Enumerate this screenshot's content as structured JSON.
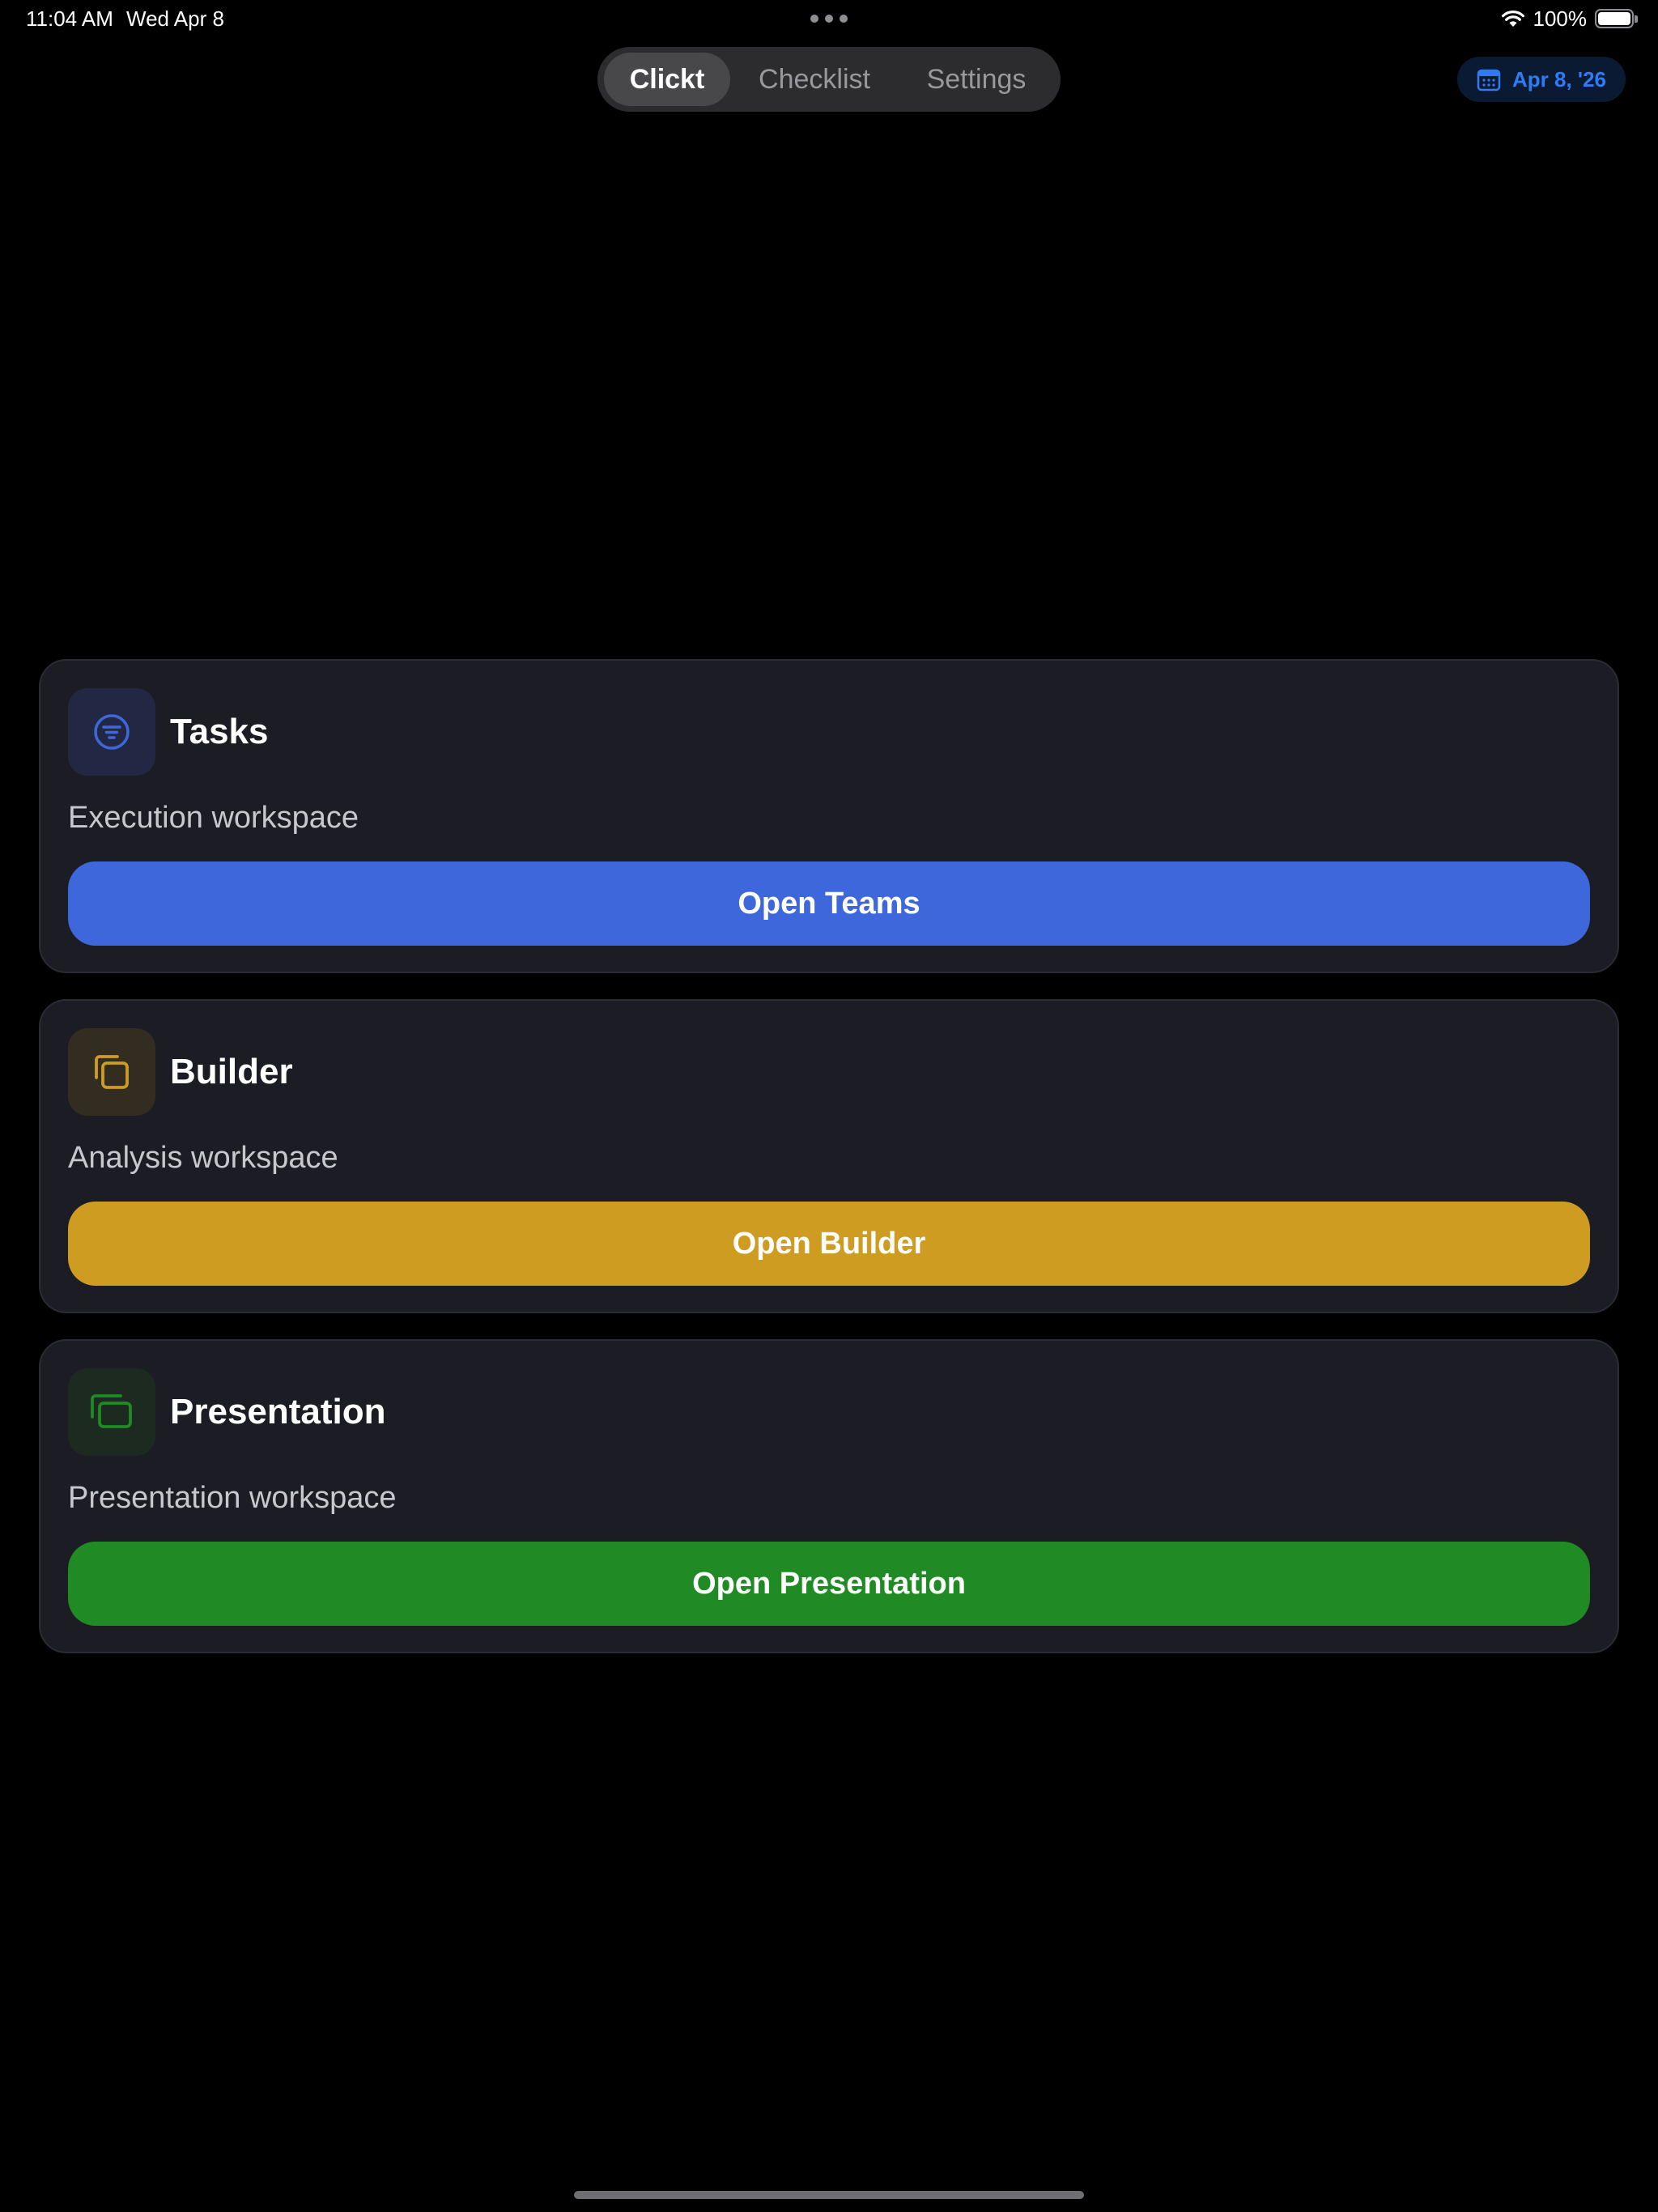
{
  "status_bar": {
    "time": "11:04 AM",
    "date": "Wed Apr 8",
    "battery": "100%",
    "battery_level": 1.0,
    "icons": [
      "multitasking-dots-icon",
      "wifi-icon",
      "battery-icon"
    ]
  },
  "tabs": [
    {
      "label": "Clickt",
      "active": true
    },
    {
      "label": "Checklist",
      "active": false
    },
    {
      "label": "Settings",
      "active": false
    }
  ],
  "date_button": {
    "label": "Apr 8, '26",
    "icon": "calendar-icon",
    "color": "#2f7bf5"
  },
  "cards": [
    {
      "title": "Tasks",
      "subtitle": "Execution workspace",
      "button_label": "Open Teams",
      "icon": "filter-list-icon",
      "accent": "#3f67dc"
    },
    {
      "title": "Builder",
      "subtitle": "Analysis workspace",
      "button_label": "Open Builder",
      "icon": "stacked-squares-icon",
      "accent": "#cf9c22"
    },
    {
      "title": "Presentation",
      "subtitle": "Presentation workspace",
      "button_label": "Open Presentation",
      "icon": "stacked-rectangles-icon",
      "accent": "#208a24"
    }
  ]
}
